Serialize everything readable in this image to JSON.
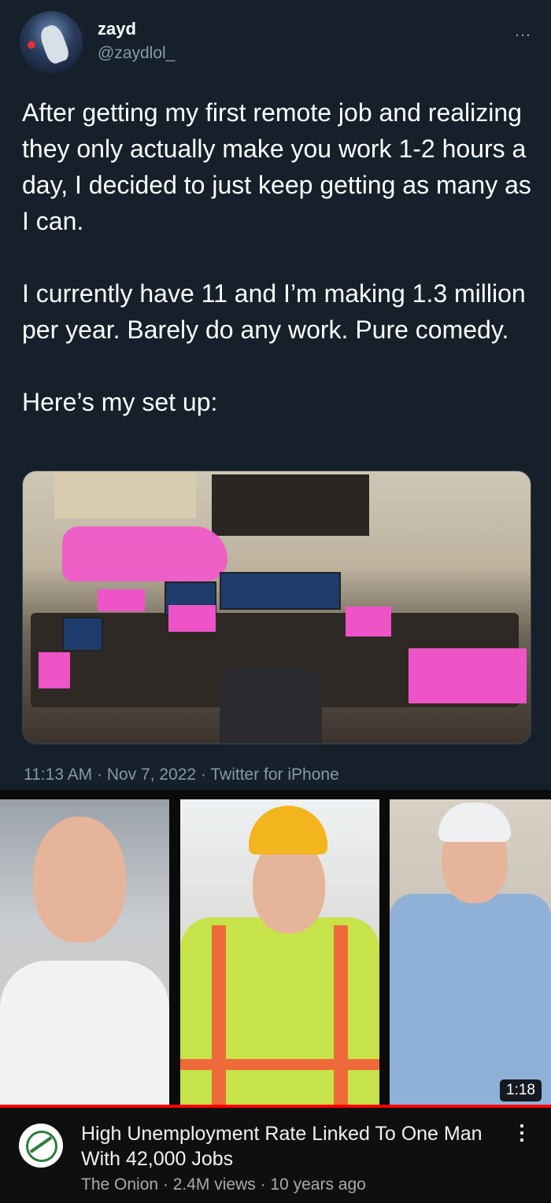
{
  "tweet": {
    "display_name": "zayd",
    "handle": "@zaydlol_",
    "more_icon": "…",
    "text": "After getting my first remote job and realizing they only actually make you work 1-2 hours a day, I decided to just keep getting as many as I can.\n\nI currently have 11 and I’m making 1.3 million per year. Barely do any work. Pure comedy.\n\nHere’s my set up:",
    "meta": "11:13 AM · Nov 7, 2022 · Twitter for iPhone"
  },
  "video": {
    "duration": "1:18",
    "title": "High Unemployment Rate Linked To One Man With 42,000 Jobs",
    "channel": "The Onion · 2.4M views · 10 years ago",
    "menu_icon": "⋮"
  },
  "colors": {
    "background": "#15202b",
    "text_secondary": "#8899a6",
    "progress": "#ff0000"
  }
}
